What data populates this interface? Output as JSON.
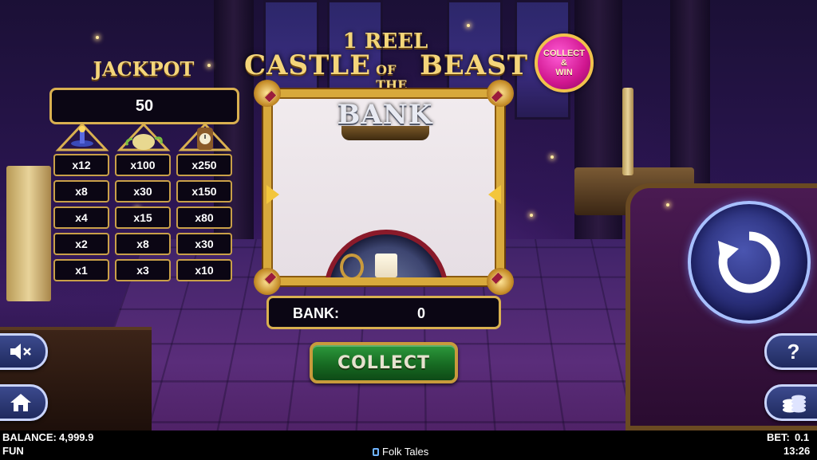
{
  "game": {
    "title_line1": "1 REEL",
    "title_word1": "CASTLE",
    "title_word2": "OF THE",
    "title_word3": "BEAST",
    "badge": [
      "COLLECT",
      "&",
      "WIN"
    ]
  },
  "jackpot": {
    "label": "JACKPOT",
    "value": "50",
    "symbols": [
      "lamp-icon",
      "teapot-icon",
      "clock-icon"
    ],
    "rows": [
      [
        "x12",
        "x100",
        "x250"
      ],
      [
        "x8",
        "x30",
        "x150"
      ],
      [
        "x4",
        "x15",
        "x80"
      ],
      [
        "x2",
        "x8",
        "x30"
      ],
      [
        "x1",
        "x3",
        "x10"
      ]
    ]
  },
  "reel": {
    "banner": "BANK"
  },
  "bank": {
    "label": "BANK:",
    "value": "0"
  },
  "collect_button": "COLLECT",
  "controls": {
    "help": "?"
  },
  "status_bar": {
    "balance_label": "BALANCE:",
    "balance_value": "4,999.9",
    "mode": "FUN",
    "provider": "Folk Tales",
    "bet_label": "BET:",
    "bet_value": "0.1",
    "time": "13:26"
  },
  "colors": {
    "gold": "#d9b050",
    "collect_green": "#176a22",
    "spin_blue": "#2a2f7a",
    "badge_pink": "#d0168f"
  }
}
